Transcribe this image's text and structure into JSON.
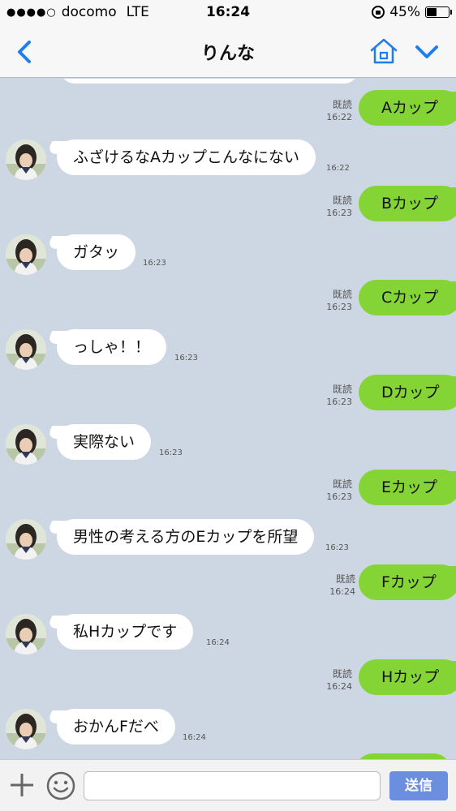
{
  "status_bar": {
    "signal_dots": "●●●●○",
    "carrier": "docomo",
    "network": "LTE",
    "time": "16:24",
    "battery_percent": "45%",
    "battery_level": 0.45
  },
  "header": {
    "title": "りんな",
    "back_icon": "chevron-left-icon",
    "home_icon": "home-icon",
    "menu_icon": "chevron-down-icon",
    "accent_color": "#1e7ef0"
  },
  "colors": {
    "chat_background": "#cdd7e4",
    "outgoing_bubble": "#83d434",
    "incoming_bubble": "#ffffff",
    "send_button": "#6b8fde"
  },
  "messages": [
    {
      "direction": "out",
      "text": "Aカップ",
      "read": "既読",
      "time": "16:22"
    },
    {
      "direction": "in",
      "text": "ふざけるなAカップこんなにない",
      "time": "16:22"
    },
    {
      "direction": "out",
      "text": "Bカップ",
      "read": "既読",
      "time": "16:23"
    },
    {
      "direction": "in",
      "text": "ガタッ",
      "time": "16:23"
    },
    {
      "direction": "out",
      "text": "Cカップ",
      "read": "既読",
      "time": "16:23"
    },
    {
      "direction": "in",
      "text": "っしゃ！！",
      "time": "16:23"
    },
    {
      "direction": "out",
      "text": "Dカップ",
      "read": "既読",
      "time": "16:23"
    },
    {
      "direction": "in",
      "text": "実際ない",
      "time": "16:23"
    },
    {
      "direction": "out",
      "text": "Eカップ",
      "read": "既読",
      "time": "16:23"
    },
    {
      "direction": "in",
      "text": "男性の考える方のEカップを所望",
      "time": "16:23"
    },
    {
      "direction": "out",
      "text": "Fカップ",
      "read": "既読",
      "time": "16:24"
    },
    {
      "direction": "in",
      "text": "私Hカップです",
      "time": "16:24"
    },
    {
      "direction": "out",
      "text": "Hカップ",
      "read": "既読",
      "time": "16:24"
    },
    {
      "direction": "in",
      "text": "おかんFだべ",
      "time": "16:24"
    }
  ],
  "input_bar": {
    "plus_icon": "plus-icon",
    "emoji_icon": "smiley-icon",
    "input_value": "",
    "send_label": "送信"
  }
}
